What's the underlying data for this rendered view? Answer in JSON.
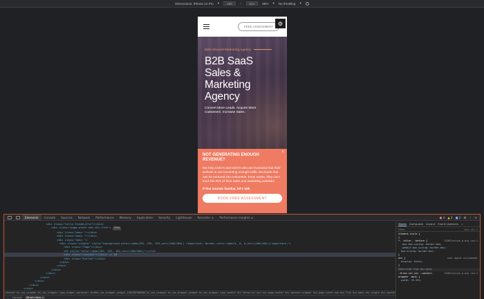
{
  "device_toolbar": {
    "dimensions_label": "Dimensions: iPhone 12 Pro",
    "width": "390",
    "height": "844",
    "zoom": "85%",
    "throttle": "No throttling"
  },
  "site": {
    "free_assessment_button": "FREE ASSESSMENT",
    "hero": {
      "eyebrow": "B2B Inbound Marketing Agency",
      "title": "B2B SaaS Sales & Marketing Agency",
      "subtitle": "Convert More Leads. Acquire More Customers. Increase Sales."
    },
    "promo": {
      "title": "NOT GENERATING ENOUGH REVENUE?",
      "body": "We help CMO's and CEO's who are frustrated that their website is not converting enough traffic into leads that can be nurtured into customers. Even worse, they can't track the ROI of their sales and marketing activities.",
      "cta_text": "If that sounds familiar, let's talk.",
      "button": "BOOK FREE ASSESSMENT",
      "close": "×"
    }
  },
  "devtools": {
    "tabs": [
      "Elements",
      "Console",
      "Sources",
      "Network",
      "Performance",
      "Memory",
      "Application",
      "Security",
      "Lighthouse",
      "Recorder ⚓",
      "Performance insights ⚓"
    ],
    "active_tab": "Elements",
    "counts": {
      "errors": "4",
      "warnings": "2",
      "info": "2"
    },
    "elements_lines": [
      {
        "indent": 60,
        "html": "<div class=\"title thiddlitle\"></div>"
      },
      {
        "indent": 68,
        "html": "<div class=\"page-width new div-flex\">",
        "badge": "flex"
      },
      {
        "indent": 76,
        "html": "<div class=\"main \"></div>"
      },
      {
        "indent": 76,
        "html": "<div class=\"main \"></div>"
      },
      {
        "indent": 76,
        "html": "<div class=\"main \">"
      },
      {
        "indent": 80,
        "html": "<div class=\"single\" style=\"background-color:rgba(255, 255, 255,calc(100/100)) !important;       border-color:rgba(0, 0, 0,calc(100/100))!important;\">"
      },
      {
        "indent": 86,
        "html": "<div class=\"logo\"></div>"
      },
      {
        "indent": 86,
        "html": "<h1 style=\"color:rgba(102, 102, 102,calc(100/100))\"></h1>"
      },
      {
        "indent": 86,
        "html": "<div class=\"content\"></div> == $0",
        "selected": true
      },
      {
        "indent": 86,
        "html": "<div class=\"button\"></div>"
      },
      {
        "indent": 80,
        "html": "</div>"
      },
      {
        "indent": 76,
        "html": "</div>"
      },
      {
        "indent": 68,
        "html": "</div>"
      },
      {
        "indent": 60,
        "html": "</div>"
      },
      {
        "indent": 52,
        "html": "</div>"
      },
      {
        "indent": 44,
        "html": "</div>"
      },
      {
        "indent": 36,
        "html": "</div>"
      },
      {
        "indent": 28,
        "html": "</div>"
      }
    ],
    "breadcrumb": "ntainer.hs_cos_wrapper.hs_cos_wrapper_type_widget_container   div#hs_cos_wrapper_widget_1581587066566.hs_cos_wrapper.hs_cos_wrapper_widget.hs_cos_wrapper_type_module   div.three-col-sec   div.page-center   div.content-wrapper   div.page-width.new.div-flex   div.main   div.single   div.content",
    "drawer_tabs": [
      "Console",
      "What's New ×"
    ],
    "styles_tabs": [
      "Styles",
      "Computed",
      "Layout",
      "Event Listeners",
      "»"
    ],
    "styles_filter": "Filter",
    "styles_filter_right": ":hov .cls + ",
    "styles_rules": [
      {
        "type": "sel",
        "text": "element.style {"
      },
      {
        "type": "sel",
        "text": "}"
      },
      {
        "type": "sel",
        "text": "*, :after, :before {",
        "src": "310ECrative_m.min.css:1"
      },
      {
        "type": "prop",
        "text": "-moz-box-sizing: border-box;"
      },
      {
        "type": "prop",
        "text": "-webkit-box-sizing: border-box;"
      },
      {
        "type": "prop",
        "text": "box-sizing: border-box;"
      },
      {
        "type": "sel",
        "text": "}"
      },
      {
        "type": "sel",
        "text": "div {",
        "src": "user agent stylesheet"
      },
      {
        "type": "prop",
        "text": "display: block;"
      },
      {
        "type": "sel",
        "text": "}"
      },
      {
        "type": "hd",
        "text": "Inherited from div.main"
      },
      {
        "type": "sel",
        "text": ".three-col-sec .content-",
        "src": "310ECrative_m.min.css:1"
      },
      {
        "type": "sel",
        "text": "wrapper .main {"
      },
      {
        "type": "prop",
        "text": "width: 33.33%;"
      }
    ]
  }
}
